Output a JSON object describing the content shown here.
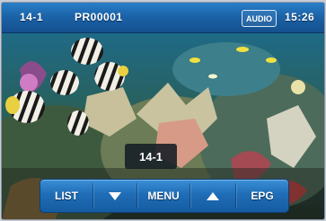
{
  "status_bar": {
    "channel": "14-1",
    "program": "PR00001",
    "audio_label": "AUDIO",
    "time": "15:26"
  },
  "overlay": {
    "channel_number": "14-1"
  },
  "controls": {
    "list_label": "LIST",
    "down_icon": "triangle-down",
    "menu_label": "MENU",
    "up_icon": "triangle-up",
    "epg_label": "EPG"
  },
  "colors": {
    "bar_blue": "#1f6db6",
    "bar_border": "#0f3f73"
  }
}
